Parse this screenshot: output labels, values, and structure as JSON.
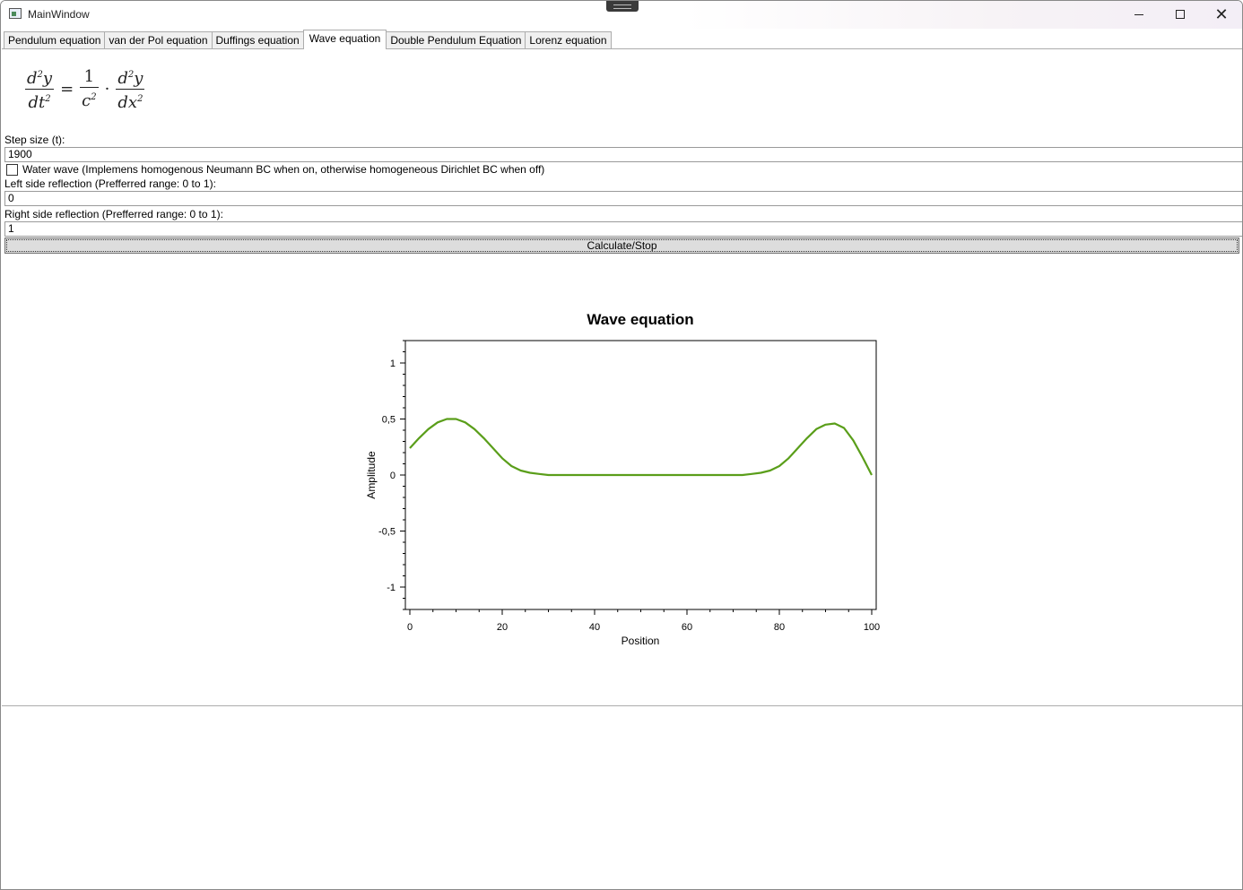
{
  "window": {
    "title": "MainWindow"
  },
  "tabs": [
    {
      "label": "Pendulum equation"
    },
    {
      "label": "van der Pol equation"
    },
    {
      "label": "Duffings equation"
    },
    {
      "label": "Wave equation"
    },
    {
      "label": "Double Pendulum Equation"
    },
    {
      "label": "Lorenz equation"
    }
  ],
  "active_tab": "Wave equation",
  "form": {
    "step_label": "Step size (t):",
    "step_value": "1900",
    "water_wave_label": "Water wave (Implemens homogenous Neumann BC when on, otherwise homogeneous Dirichlet BC when off)",
    "water_wave_checked": false,
    "left_label": "Left side reflection (Prefferred range: 0 to 1):",
    "left_value": "0",
    "right_label": "Right side reflection (Prefferred range: 0 to 1):",
    "right_value": "1",
    "calc_button": "Calculate/Stop"
  },
  "chart_data": {
    "type": "line",
    "title": "Wave equation",
    "xlabel": "Position",
    "ylabel": "Amplitude",
    "xlim": [
      0,
      100
    ],
    "ylim": [
      -1.2,
      1.2
    ],
    "xticks": [
      "0",
      "20",
      "40",
      "60",
      "80",
      "100"
    ],
    "yticks": [
      "1",
      "0,5",
      "0",
      "-0,5",
      "-1"
    ],
    "series": [
      {
        "color": "#5a9e1a",
        "x": [
          0,
          2,
          4,
          6,
          8,
          10,
          12,
          14,
          16,
          18,
          20,
          22,
          24,
          26,
          28,
          30,
          35,
          40,
          50,
          60,
          65,
          70,
          72,
          74,
          76,
          78,
          80,
          82,
          84,
          86,
          88,
          90,
          92,
          94,
          96,
          98,
          100
        ],
        "y": [
          0.24,
          0.33,
          0.41,
          0.47,
          0.5,
          0.5,
          0.47,
          0.41,
          0.33,
          0.24,
          0.15,
          0.08,
          0.04,
          0.02,
          0.01,
          0.0,
          0.0,
          0.0,
          0.0,
          0.0,
          0.0,
          0.0,
          0.0,
          0.01,
          0.02,
          0.04,
          0.08,
          0.15,
          0.24,
          0.33,
          0.41,
          0.45,
          0.46,
          0.42,
          0.31,
          0.16,
          0.0
        ]
      }
    ]
  }
}
